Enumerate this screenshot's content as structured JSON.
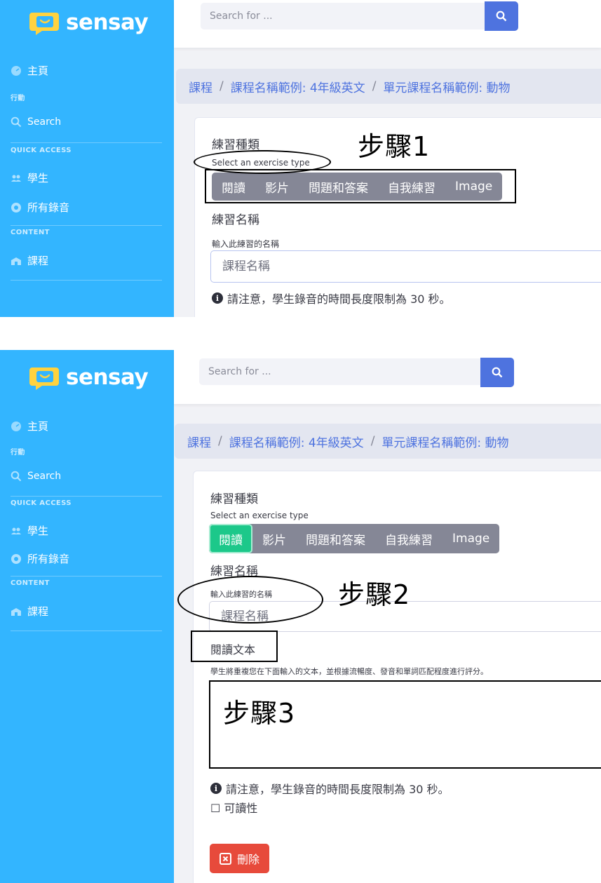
{
  "brand": {
    "name": "sensay"
  },
  "sidebar": {
    "home": "主頁",
    "section_actions": "行動",
    "search": "Search",
    "section_quick": "QUICK ACCESS",
    "students": "學生",
    "recordings": "所有錄音",
    "section_content": "CONTENT",
    "courses": "課程"
  },
  "search": {
    "placeholder": "Search for ..."
  },
  "breadcrumb": [
    "課程",
    "課程名稱範例: 4年級英文",
    "單元課程名稱範例: 動物"
  ],
  "breadcrumb_sep": "/",
  "form": {
    "exercise_type_label": "練習種類",
    "exercise_type_hint": "Select an exercise type",
    "exercise_types": [
      "閱讀",
      "影片",
      "問題和答案",
      "自我練習",
      "Image"
    ],
    "name_label": "練習名稱",
    "name_hint": "輸入此練習的名稱",
    "name_placeholder": "課程名稱",
    "note": "請注意，學生錄音的時間長度限制為 30 秒。",
    "reading_text_label": "閱讀文本",
    "reading_text_hint": "學生將重複您在下面輸入的文本，並根據流暢度、發音和單詞匹配程度進行評分。",
    "readability_label": "☐ 可讀性",
    "delete_label": "刪除"
  },
  "annotations": {
    "step1": "步驟1",
    "step2": "步驟2",
    "step3": "步驟3"
  },
  "selected_exercise_type_panel2": "閱讀",
  "colors": {
    "sidebar": "#33b5ff",
    "primary": "#4e73df",
    "success": "#1cc88a",
    "danger": "#e74a3b",
    "secondary": "#858796"
  }
}
